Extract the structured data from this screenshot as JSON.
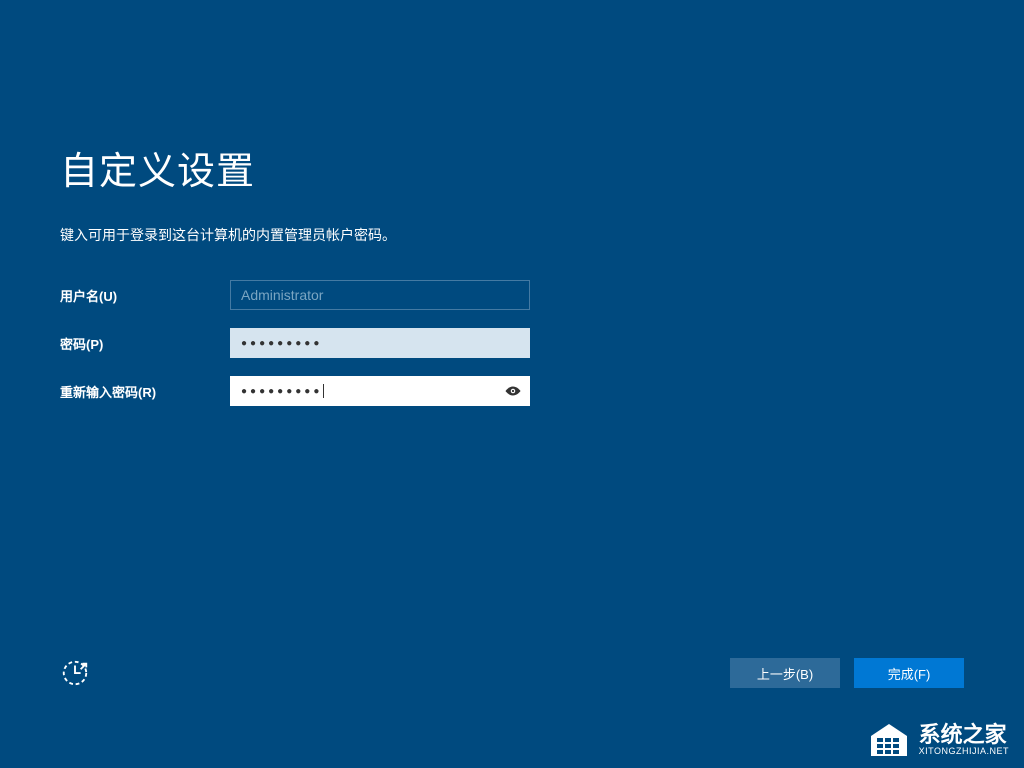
{
  "title": "自定义设置",
  "subtitle": "键入可用于登录到这台计算机的内置管理员帐户密码。",
  "form": {
    "username_label": "用户名(U)",
    "username_value": "Administrator",
    "password_label": "密码(P)",
    "password_value": "●●●●●●●●●",
    "confirm_label": "重新输入密码(R)",
    "confirm_value": "●●●●●●●●●"
  },
  "buttons": {
    "back": "上一步(B)",
    "finish": "完成(F)"
  },
  "watermark": {
    "main": "系统之家",
    "sub": "XITONGZHIJIA.NET"
  }
}
